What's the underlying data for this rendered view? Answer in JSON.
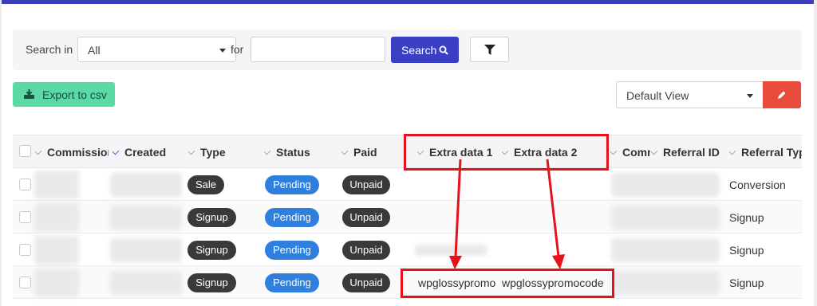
{
  "search_bar": {
    "search_in_label": "Search in",
    "search_in_value": "All",
    "for_label": "for",
    "query_value": "",
    "search_button": "Search",
    "filter_icon": "filter-icon"
  },
  "toolbar": {
    "export_label": "Export to csv",
    "view_value": "Default View",
    "edit_icon": "pencil-icon"
  },
  "table": {
    "headers": {
      "commission": "Commission",
      "created": "Created",
      "type": "Type",
      "status": "Status",
      "paid": "Paid",
      "extra1": "Extra data 1",
      "extra2": "Extra data 2",
      "comm": "Commission",
      "referral_id": "Referral ID",
      "referral_type": "Referral Type"
    },
    "rows": [
      {
        "type": "Sale",
        "status": "Pending",
        "paid": "Unpaid",
        "extra1": "",
        "extra2": "",
        "referral_type": "Conversion"
      },
      {
        "type": "Signup",
        "status": "Pending",
        "paid": "Unpaid",
        "extra1": "",
        "extra2": "",
        "referral_type": "Signup"
      },
      {
        "type": "Signup",
        "status": "Pending",
        "paid": "Unpaid",
        "extra1": "",
        "extra2": "",
        "referral_type": "Signup"
      },
      {
        "type": "Signup",
        "status": "Pending",
        "paid": "Unpaid",
        "extra1": "wpglossypromo",
        "extra2": "wpglossypromocode",
        "referral_type": "Signup"
      }
    ]
  },
  "colors": {
    "accent": "#3b3fc4",
    "export": "#5bd9a7",
    "edit": "#e74c3c",
    "status_badge": "#2f7fde",
    "dark_badge": "#3a3a3a",
    "annotation": "#e8101a"
  }
}
